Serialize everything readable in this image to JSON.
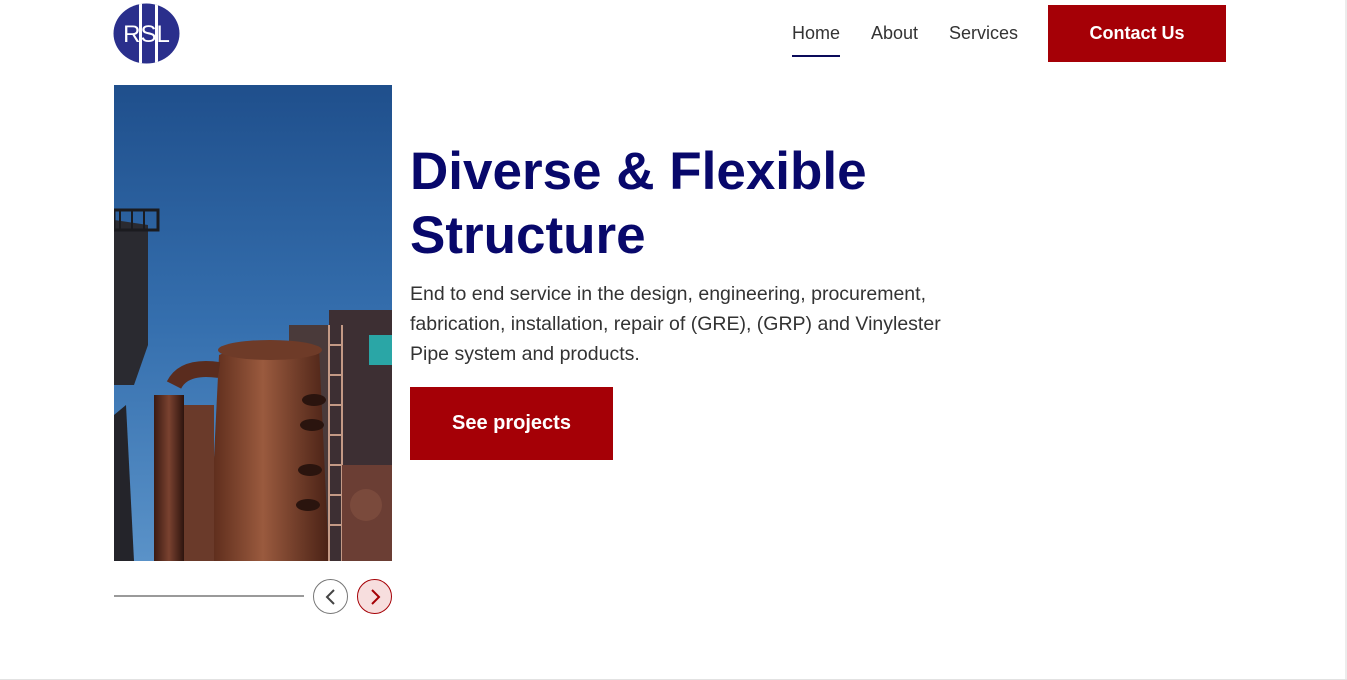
{
  "brand": {
    "logo_text": "RSL",
    "logo_color": "#2a2f8c"
  },
  "nav": {
    "items": [
      {
        "label": "Home",
        "active": true
      },
      {
        "label": "About",
        "active": false
      },
      {
        "label": "Services",
        "active": false
      }
    ],
    "contact_label": "Contact Us"
  },
  "hero": {
    "title": "Diverse & Flexible Structure",
    "description": "End to end service in the design, engineering, procurement, fabrication, installation, repair of (GRE), (GRP) and Vinylester Pipe system and products.",
    "cta_label": "See projects",
    "image_subject": "industrial-rusted-tanks-photo"
  },
  "slider": {
    "prev_icon": "chevron-left-icon",
    "next_icon": "chevron-right-icon"
  },
  "colors": {
    "accent": "#a50006",
    "heading": "#08086b",
    "text": "#333333"
  }
}
